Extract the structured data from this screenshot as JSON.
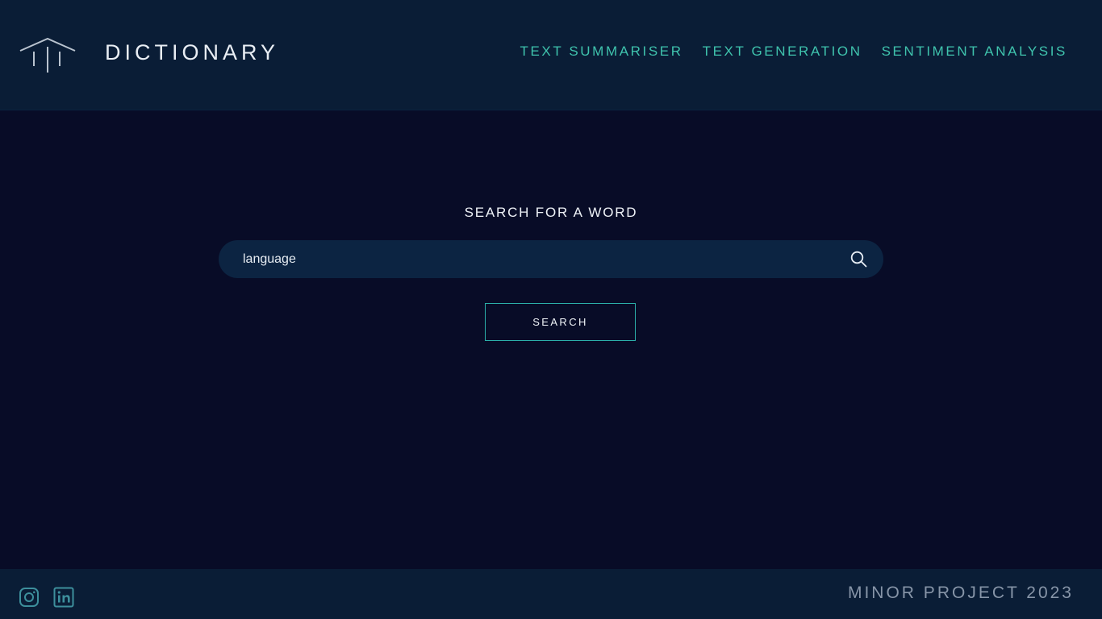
{
  "header": {
    "brand": "DICTIONARY",
    "logo_icon": "pillars-icon",
    "nav": [
      {
        "label": "TEXT SUMMARISER"
      },
      {
        "label": "TEXT GENERATION"
      },
      {
        "label": "SENTIMENT ANALYSIS"
      }
    ]
  },
  "main": {
    "title": "SEARCH FOR A WORD",
    "search": {
      "value": "language",
      "icon": "search-icon"
    },
    "button_label": "SEARCH"
  },
  "footer": {
    "social": [
      {
        "icon": "instagram-icon"
      },
      {
        "icon": "linkedin-icon"
      }
    ],
    "text": "MINOR PROJECT 2023"
  },
  "colors": {
    "background": "#080c27",
    "header_bg": "#0a1d36",
    "accent": "#3fc3ad",
    "search_bg": "#0c2442",
    "button_border": "#2bb0a9"
  }
}
